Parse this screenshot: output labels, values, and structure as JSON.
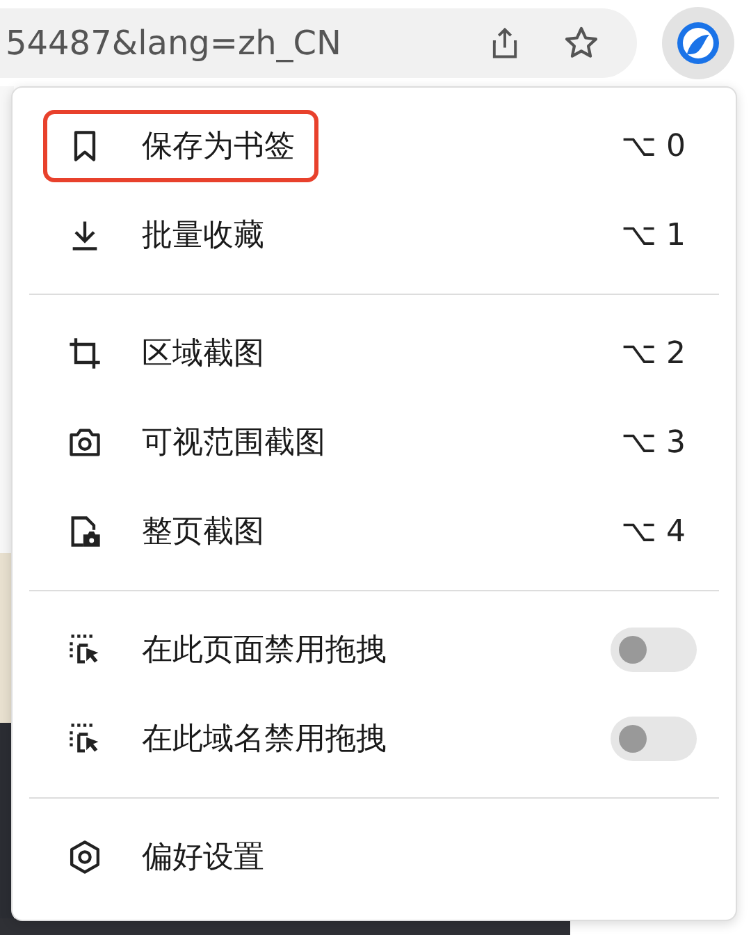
{
  "address_bar": {
    "url": "54487&lang=zh_CN"
  },
  "menu": {
    "sections": [
      {
        "items": [
          {
            "kind": "action",
            "label": "保存为书签",
            "shortcut": "⌥ 0",
            "highlighted": true
          },
          {
            "kind": "action",
            "label": "批量收藏",
            "shortcut": "⌥ 1",
            "highlighted": false
          }
        ]
      },
      {
        "items": [
          {
            "kind": "action",
            "label": "区域截图",
            "shortcut": "⌥ 2",
            "highlighted": false
          },
          {
            "kind": "action",
            "label": "可视范围截图",
            "shortcut": "⌥ 3",
            "highlighted": false
          },
          {
            "kind": "action",
            "label": "整页截图",
            "shortcut": "⌥ 4",
            "highlighted": false
          }
        ]
      },
      {
        "items": [
          {
            "kind": "toggle",
            "label": "在此页面禁用拖拽",
            "on": false
          },
          {
            "kind": "toggle",
            "label": "在此域名禁用拖拽",
            "on": false
          }
        ]
      },
      {
        "items": [
          {
            "kind": "action",
            "label": "偏好设置",
            "highlighted": false
          }
        ]
      }
    ]
  }
}
